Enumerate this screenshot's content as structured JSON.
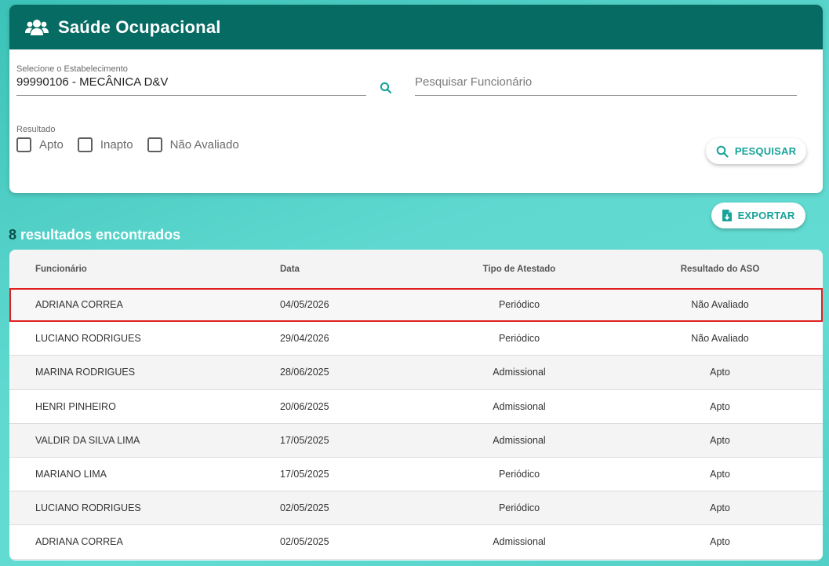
{
  "header": {
    "title": "Saúde Ocupacional",
    "icon": "users-icon"
  },
  "filters": {
    "establishment_label": "Selecione o Estabelecimento",
    "establishment_value": "99990106 - MECÂNICA D&V",
    "employee_placeholder": "Pesquisar Funcionário",
    "result_label": "Resultado",
    "checkboxes": [
      {
        "label": "Apto",
        "checked": false
      },
      {
        "label": "Inapto",
        "checked": false
      },
      {
        "label": "Não Avaliado",
        "checked": false
      }
    ],
    "search_button": "PESQUISAR"
  },
  "export_button": "EXPORTAR",
  "results": {
    "count": "8",
    "text": "resultados encontrados"
  },
  "table": {
    "columns": [
      "Funcionário",
      "Data",
      "Tipo de Atestado",
      "Resultado do ASO"
    ],
    "rows": [
      {
        "name": "ADRIANA CORREA",
        "date": "04/05/2026",
        "type": "Periódico",
        "result": "Não Avaliado"
      },
      {
        "name": "LUCIANO RODRIGUES",
        "date": "29/04/2026",
        "type": "Periódico",
        "result": "Não Avaliado"
      },
      {
        "name": "MARINA RODRIGUES",
        "date": "28/06/2025",
        "type": "Admissional",
        "result": "Apto"
      },
      {
        "name": "HENRI PINHEIRO",
        "date": "20/06/2025",
        "type": "Admissional",
        "result": "Apto"
      },
      {
        "name": "VALDIR DA SILVA LIMA",
        "date": "17/05/2025",
        "type": "Admissional",
        "result": "Apto"
      },
      {
        "name": "MARIANO LIMA",
        "date": "17/05/2025",
        "type": "Periódico",
        "result": "Apto"
      },
      {
        "name": "LUCIANO RODRIGUES",
        "date": "02/05/2025",
        "type": "Periódico",
        "result": "Apto"
      },
      {
        "name": "ADRIANA CORREA",
        "date": "02/05/2025",
        "type": "Admissional",
        "result": "Apto"
      }
    ]
  },
  "colors": {
    "header": "#066b63",
    "accent": "#17a39a",
    "highlight": "#e02020"
  }
}
